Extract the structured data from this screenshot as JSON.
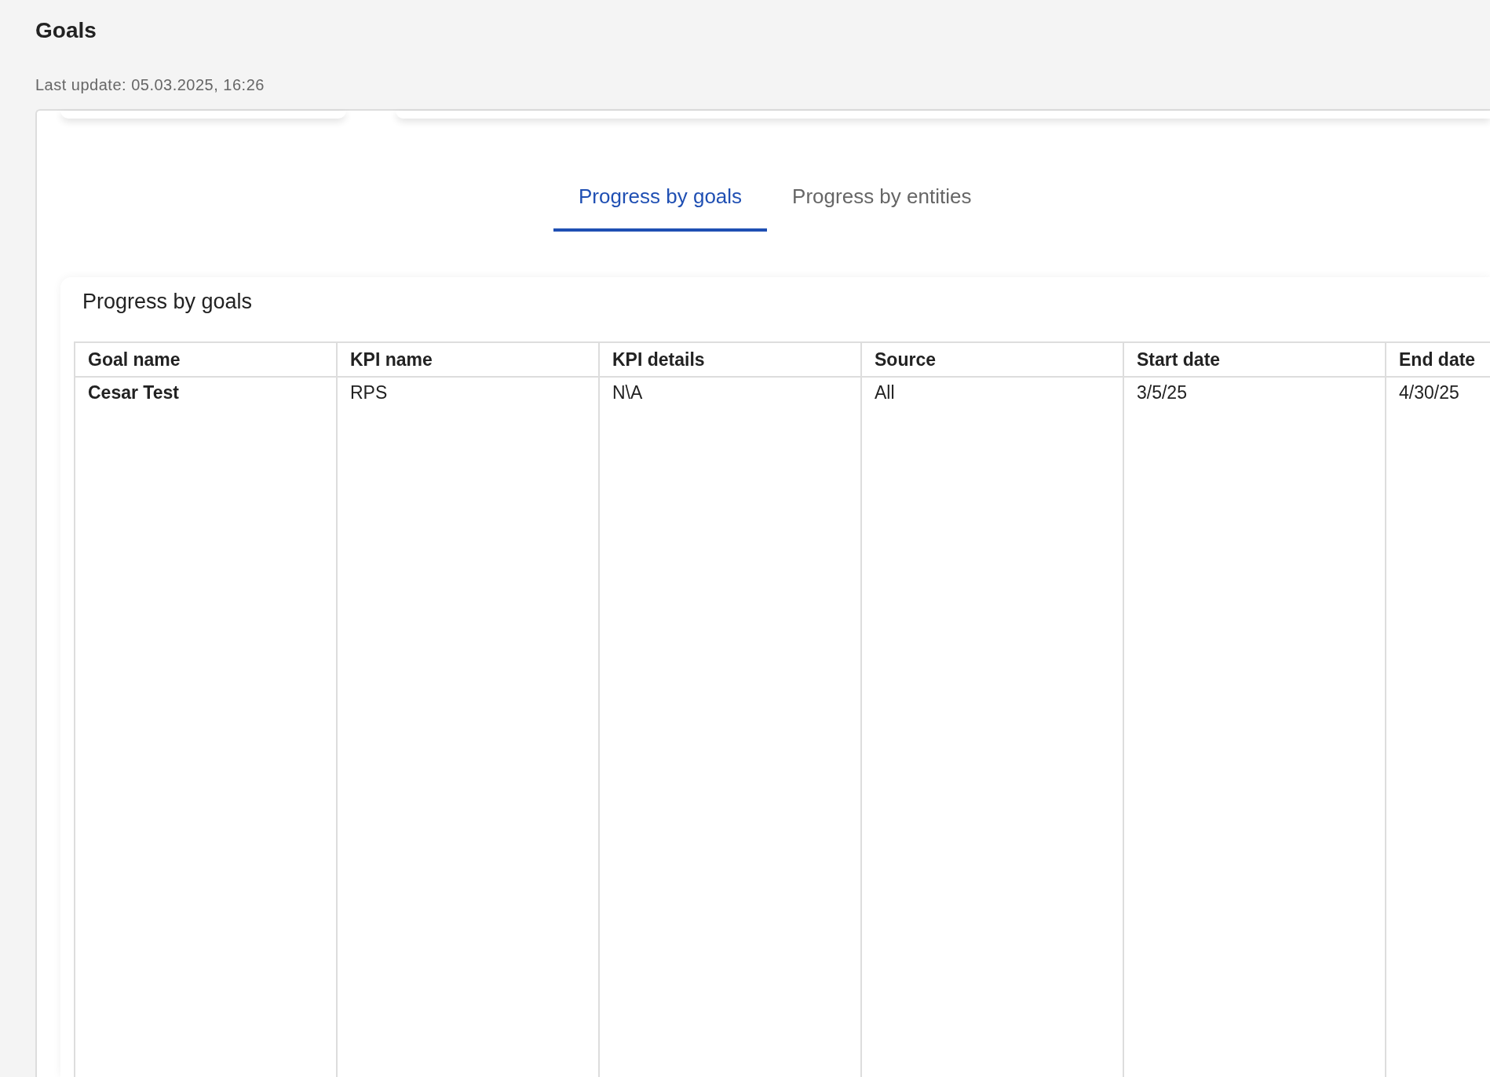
{
  "page": {
    "title": "Goals",
    "last_update": "Last update: 05.03.2025, 16:26"
  },
  "tabs": [
    {
      "label": "Progress by goals",
      "selected": true
    },
    {
      "label": "Progress by entities",
      "selected": false
    }
  ],
  "card": {
    "title": "Progress by goals"
  },
  "table": {
    "columns": [
      "Goal name",
      "KPI name",
      "KPI details",
      "Source",
      "Start date",
      "End date"
    ],
    "rows": [
      [
        "Cesar Test",
        "RPS",
        "N\\A",
        "All",
        "3/5/25",
        "4/30/25"
      ]
    ]
  }
}
